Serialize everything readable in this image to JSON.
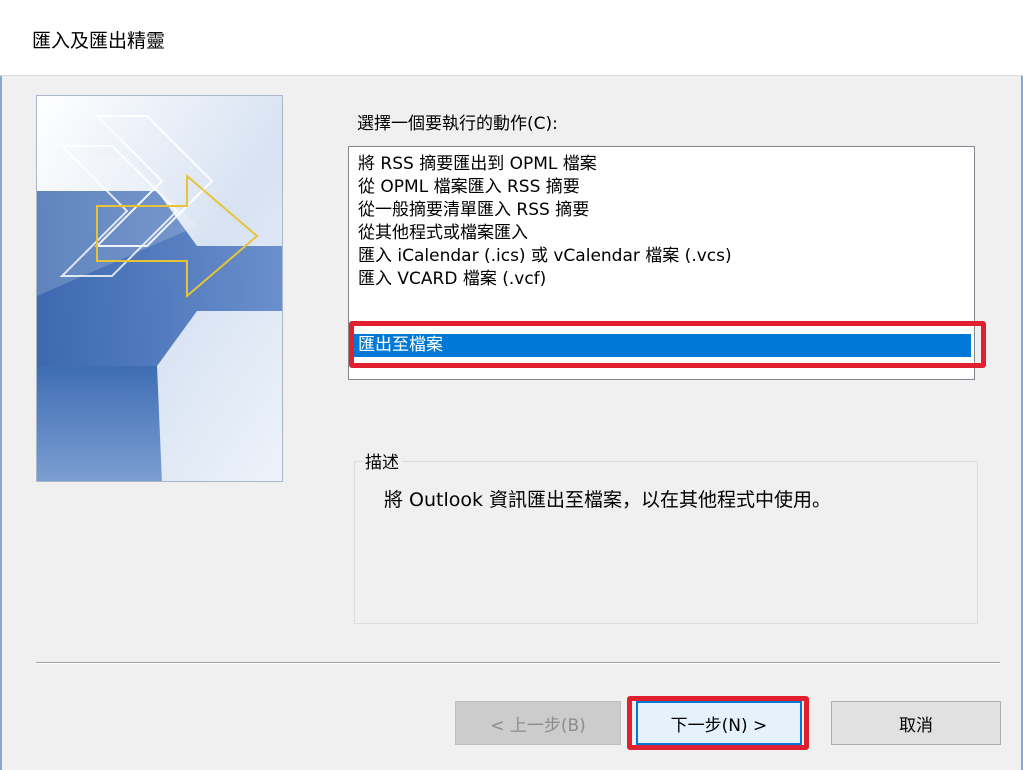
{
  "window": {
    "title": "匯入及匯出精靈"
  },
  "main": {
    "action_label": "選擇一個要執行的動作(C):",
    "actions": [
      {
        "label": "將 RSS 摘要匯出到 OPML 檔案"
      },
      {
        "label": "從 OPML 檔案匯入 RSS 摘要"
      },
      {
        "label": "從一般摘要清單匯入 RSS 摘要"
      },
      {
        "label": "從其他程式或檔案匯入"
      },
      {
        "label": "匯入 iCalendar (.ics) 或 vCalendar 檔案 (.vcs)"
      },
      {
        "label": "匯入 VCARD 檔案 (.vcf)"
      },
      {
        "label": "匯出至檔案",
        "selected": true
      }
    ],
    "selected_index": 6,
    "description": {
      "legend": "描述",
      "text": "將 Outlook 資訊匯出至檔案，以在其他程式中使用。"
    }
  },
  "buttons": {
    "back_label": "< 上一步(B)",
    "back_enabled": false,
    "next_label": "下一步(N) >",
    "cancel_label": "取消"
  },
  "colors": {
    "selection": "#0078d7",
    "annotation_highlight": "#e0202e"
  }
}
